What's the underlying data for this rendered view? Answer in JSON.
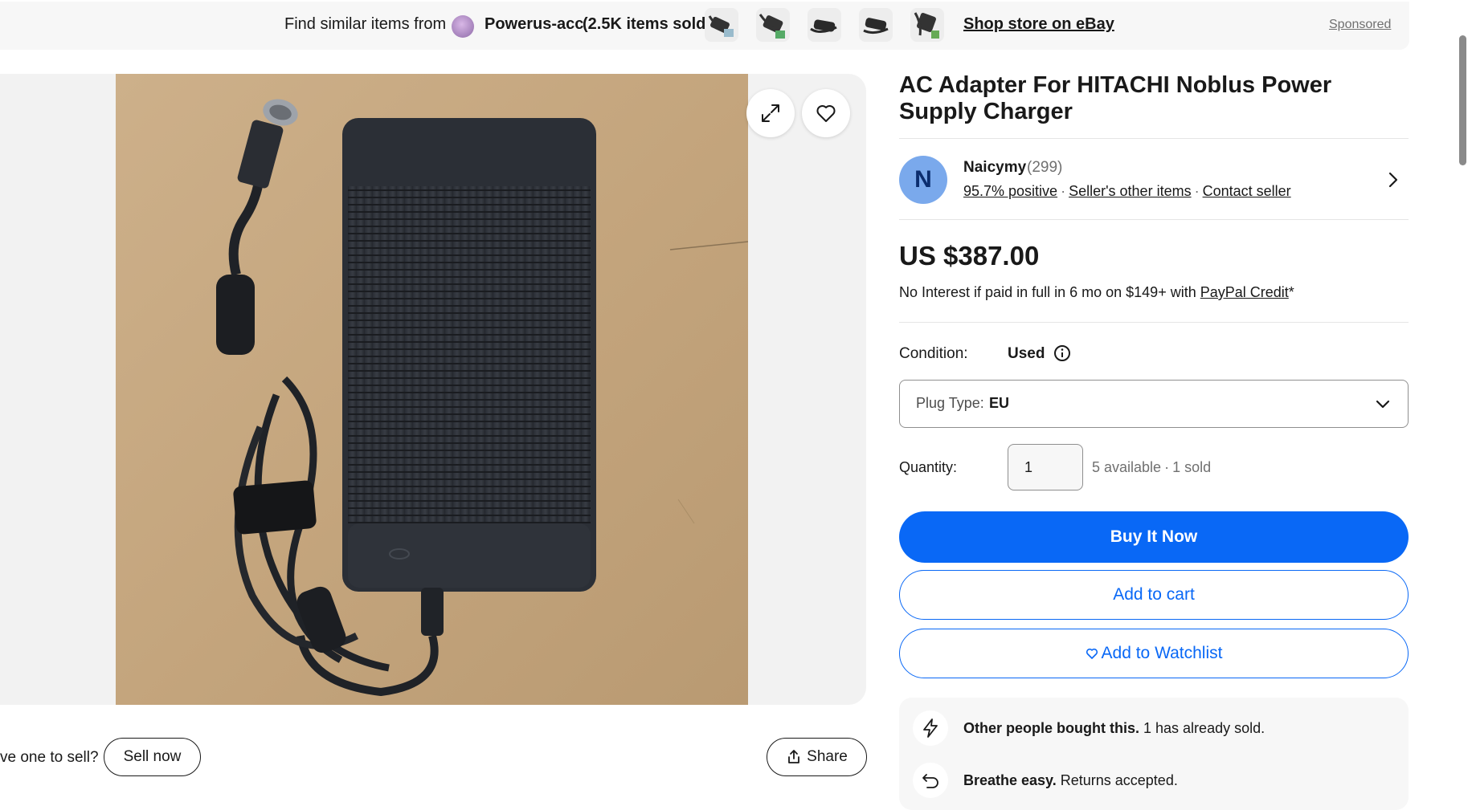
{
  "banner": {
    "prefix": "Find similar items from",
    "store_name": "Powerus-acc",
    "store_sold": "(2.5K items sold)",
    "shop_link": "Shop store on eBay",
    "sponsored": "Sponsored"
  },
  "listing": {
    "title": "AC Adapter For HITACHI Noblus Power Supply Charger",
    "price": "US $387.00",
    "credit_text": "No Interest if paid in full in 6 mo on $149+ with",
    "credit_link": "PayPal Credit",
    "credit_suffix": "*"
  },
  "seller": {
    "initial": "N",
    "name": "Naicymy",
    "count": "(299)",
    "feedback": "95.7% positive",
    "other_items": "Seller's other items",
    "contact": "Contact seller"
  },
  "condition": {
    "label": "Condition:",
    "value": "Used"
  },
  "plug": {
    "label": "Plug Type:",
    "value": "EU"
  },
  "quantity": {
    "label": "Quantity:",
    "value": "1",
    "available": "5 available",
    "sold": "1 sold"
  },
  "actions": {
    "buy": "Buy It Now",
    "cart": "Add to cart",
    "watch": "Add to Watchlist",
    "share": "Share",
    "sell": "Sell now",
    "have_one": "ve one to sell?"
  },
  "info": {
    "item1_bold": "Other people bought this.",
    "item1_rest": "1 has already sold.",
    "item2_bold": "Breathe easy.",
    "item2_rest": "Returns accepted."
  },
  "colors": {
    "accent": "#0968f6",
    "avatar": "#7aa9ec"
  }
}
